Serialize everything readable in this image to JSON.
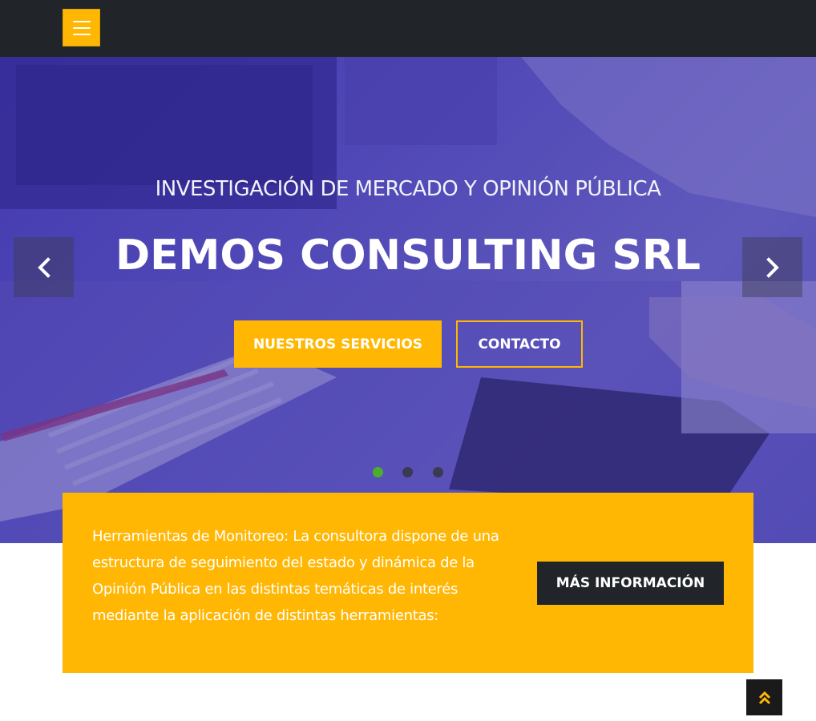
{
  "navbar": {
    "menu_icon": "hamburger-icon",
    "background": "#212529",
    "accent": "#ffb703"
  },
  "hero": {
    "subtitle": "INVESTIGACIÓN DE MERCADO Y OPINIÓN PÚBLICA",
    "title": "DEMOS CONSULTING SRL",
    "primary_button": "NUESTROS SERVICIOS",
    "secondary_button": "CONTACTO",
    "prev_icon": "chevron-left-icon",
    "next_icon": "chevron-right-icon",
    "slides_count": 3,
    "active_slide": 1,
    "indicator_active_color": "#4caf2a"
  },
  "info": {
    "text": "Herramientas de Monitoreo: La consultora dispone de una estructura de seguimiento del estado y dinámica de la Opinión Pública en las distintas temáticas de interés mediante la aplicación de distintas herramientas:",
    "button": "MÁS INFORMACIÓN"
  },
  "back_to_top": {
    "icon": "double-chevron-up-icon"
  }
}
